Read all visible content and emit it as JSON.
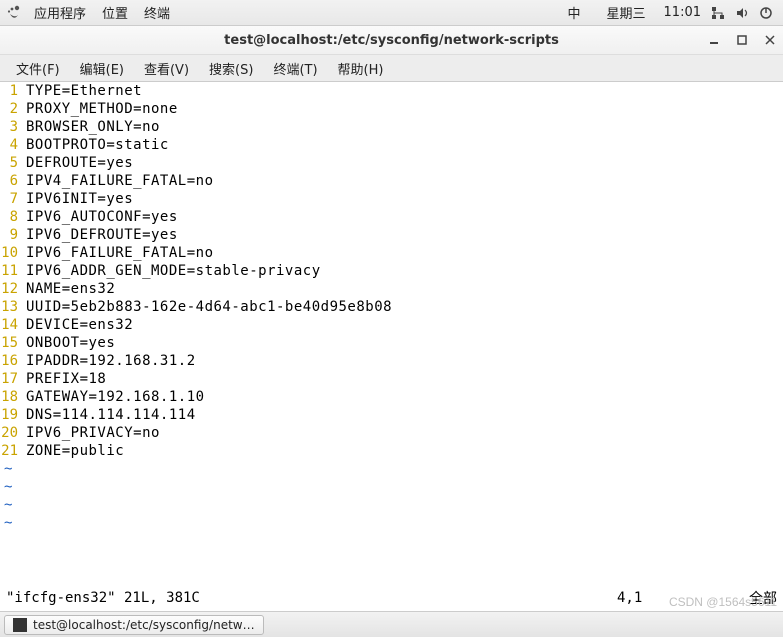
{
  "panel": {
    "apps": "应用程序",
    "places": "位置",
    "terminal": "终端",
    "ime": "中",
    "day": "星期三",
    "time": "11:01"
  },
  "window": {
    "title": "test@localhost:/etc/sysconfig/network-scripts"
  },
  "menu": {
    "file": "文件(F)",
    "edit": "编辑(E)",
    "view": "查看(V)",
    "search": "搜索(S)",
    "terminal": "终端(T)",
    "help": "帮助(H)"
  },
  "lines": [
    "TYPE=Ethernet",
    "PROXY_METHOD=none",
    "BROWSER_ONLY=no",
    "BOOTPROTO=static",
    "DEFROUTE=yes",
    "IPV4_FAILURE_FATAL=no",
    "IPV6INIT=yes",
    "IPV6_AUTOCONF=yes",
    "IPV6_DEFROUTE=yes",
    "IPV6_FAILURE_FATAL=no",
    "IPV6_ADDR_GEN_MODE=stable-privacy",
    "NAME=ens32",
    "UUID=5eb2b883-162e-4d64-abc1-be40d95e8b08",
    "DEVICE=ens32",
    "ONBOOT=yes",
    "IPADDR=192.168.31.2",
    "PREFIX=18",
    "GATEWAY=192.168.1.10",
    "DNS=114.114.114.114",
    "IPV6_PRIVACY=no",
    "ZONE=public"
  ],
  "tildes": 4,
  "status": {
    "left": "\"ifcfg-ens32\" 21L, 381C",
    "pos": "4,1",
    "right": "全部"
  },
  "taskbar": {
    "task1": "test@localhost:/etc/sysconfig/netw…"
  },
  "watermark": "CSDN @1564s5611"
}
